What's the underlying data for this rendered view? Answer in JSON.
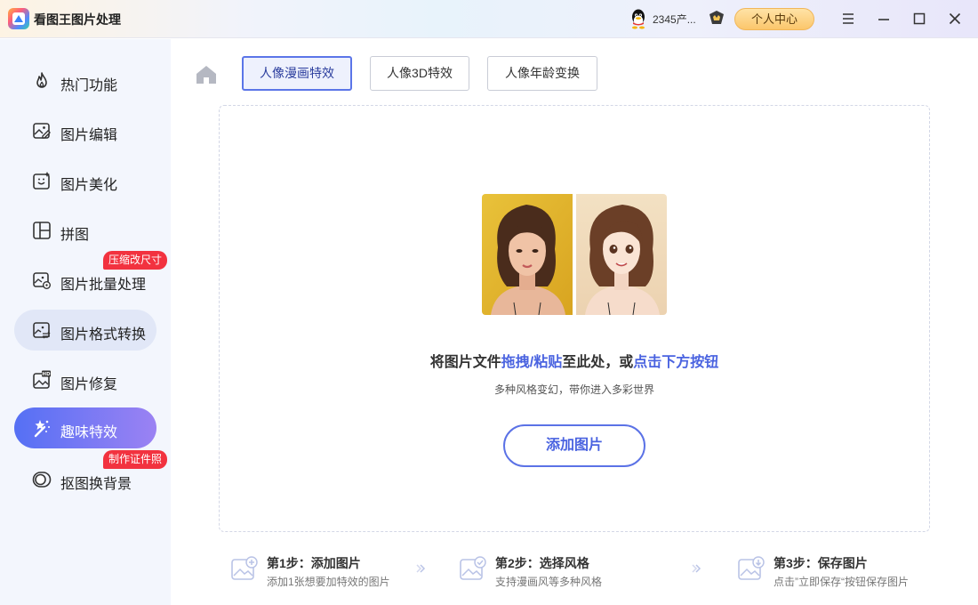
{
  "app": {
    "title": "看图王图片处理"
  },
  "header": {
    "username": "2345产...",
    "center_button": "个人中心"
  },
  "sidebar": {
    "items": [
      {
        "label": "热门功能",
        "icon": "flame-icon"
      },
      {
        "label": "图片编辑",
        "icon": "image-edit-icon"
      },
      {
        "label": "图片美化",
        "icon": "image-beautify-icon"
      },
      {
        "label": "拼图",
        "icon": "collage-icon"
      },
      {
        "label": "图片批量处理",
        "icon": "batch-icon",
        "badge": "压缩改尺寸"
      },
      {
        "label": "图片格式转换",
        "icon": "format-convert-icon"
      },
      {
        "label": "图片修复",
        "icon": "hd-repair-icon"
      },
      {
        "label": "趣味特效",
        "icon": "magic-wand-icon"
      },
      {
        "label": "抠图换背景",
        "icon": "cutout-icon",
        "badge": "制作证件照"
      }
    ]
  },
  "tabs": [
    {
      "label": "人像漫画特效"
    },
    {
      "label": "人像3D特效"
    },
    {
      "label": "人像年龄变换"
    }
  ],
  "dropzone": {
    "text_prefix": "将图片文件",
    "text_hl1": "拖拽/粘贴",
    "text_mid": "至此处，或",
    "text_hl2": "点击下方按钮",
    "subtitle": "多种风格变幻，带你进入多彩世界",
    "add_button": "添加图片"
  },
  "steps": [
    {
      "title": "第1步：添加图片",
      "desc": "添加1张想要加特效的图片"
    },
    {
      "title": "第2步：选择风格",
      "desc": "支持漫画风等多种风格"
    },
    {
      "title": "第3步：保存图片",
      "desc": "点击”立即保存“按钮保存图片"
    }
  ],
  "colors": {
    "accent": "#4a63e0",
    "active_gradient_start": "#5570f4",
    "active_gradient_end": "#9b82f3",
    "badge": "#f2323f",
    "sidebar_bg": "#f3f6fd"
  }
}
